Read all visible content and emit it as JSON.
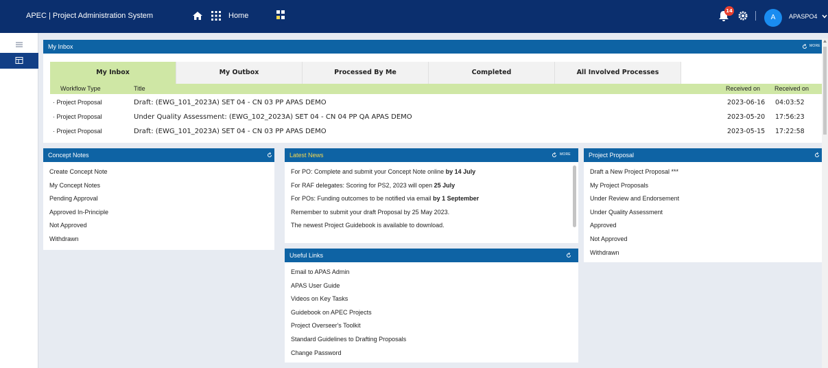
{
  "app": {
    "title": "APEC | Project Administration System",
    "home_label": "Home",
    "notification_count": "14",
    "avatar_initial": "A",
    "user_name": "APASPO4"
  },
  "inbox": {
    "title": "My Inbox",
    "more_label": "MORE",
    "tabs": [
      "My Inbox",
      "My Outbox",
      "Processed By Me",
      "Completed",
      "All Involved Processes"
    ],
    "active_tab": "My Inbox",
    "columns": {
      "type": "Workflow Type",
      "title": "Title",
      "received_date": "Received on",
      "received_time": "Received on"
    },
    "rows": [
      {
        "type": "· Project Proposal",
        "title": "Draft: (EWG_101_2023A) SET 04 - CN 03 PP APAS DEMO",
        "date": "2023-06-16",
        "time": "04:03:52"
      },
      {
        "type": "· Project Proposal",
        "title": "Under Quality Assessment: (EWG_102_2023A) SET 04 - CN 04 PP QA APAS DEMO",
        "date": "2023-05-20",
        "time": "17:56:23"
      },
      {
        "type": "· Project Proposal",
        "title": "Draft: (EWG_101_2023A) SET 04 - CN 03 PP APAS DEMO",
        "date": "2023-05-15",
        "time": "17:22:58"
      }
    ]
  },
  "concept_notes": {
    "title": "Concept Notes",
    "items": [
      "Create Concept Note",
      "My Concept Notes",
      "Pending Approval",
      "Approved In-Principle",
      "Not Approved",
      "Withdrawn"
    ]
  },
  "latest_news": {
    "title": "Latest News",
    "more_label": "MORE",
    "items": [
      {
        "text": "For PO: Complete and submit your Concept Note online ",
        "bold": "by 14 July"
      },
      {
        "text": "For RAF delegates: Scoring for PS2, 2023 will open ",
        "bold": "25 July"
      },
      {
        "text": "For POs: Funding outcomes to be notified via email ",
        "bold": "by 1 September"
      },
      {
        "text": "Remember to submit your draft Proposal by 25 May 2023.",
        "bold": ""
      },
      {
        "text": "The newest Project Guidebook is available to download.",
        "bold": ""
      }
    ]
  },
  "useful_links": {
    "title": "Useful Links",
    "items": [
      "Email to APAS Admin",
      "APAS User Guide",
      "Videos on Key Tasks",
      "Guidebook on APEC Projects",
      "Project Overseer's Toolkit",
      "Standard Guidelines to Drafting Proposals",
      "Change Password"
    ]
  },
  "project_proposal": {
    "title": "Project Proposal",
    "items": [
      "Draft a New Project Proposal ***",
      "My Project Proposals",
      "Under Review and Endorsement",
      "Under Quality Assessment",
      "Approved",
      "Not Approved",
      "Withdrawn"
    ]
  },
  "colors": {
    "topbar": "#0b2f6e",
    "panel_header": "#0e63a4",
    "active_tab": "#cfe7a5",
    "badge": "#e8402f",
    "avatar": "#1a8cf0"
  }
}
